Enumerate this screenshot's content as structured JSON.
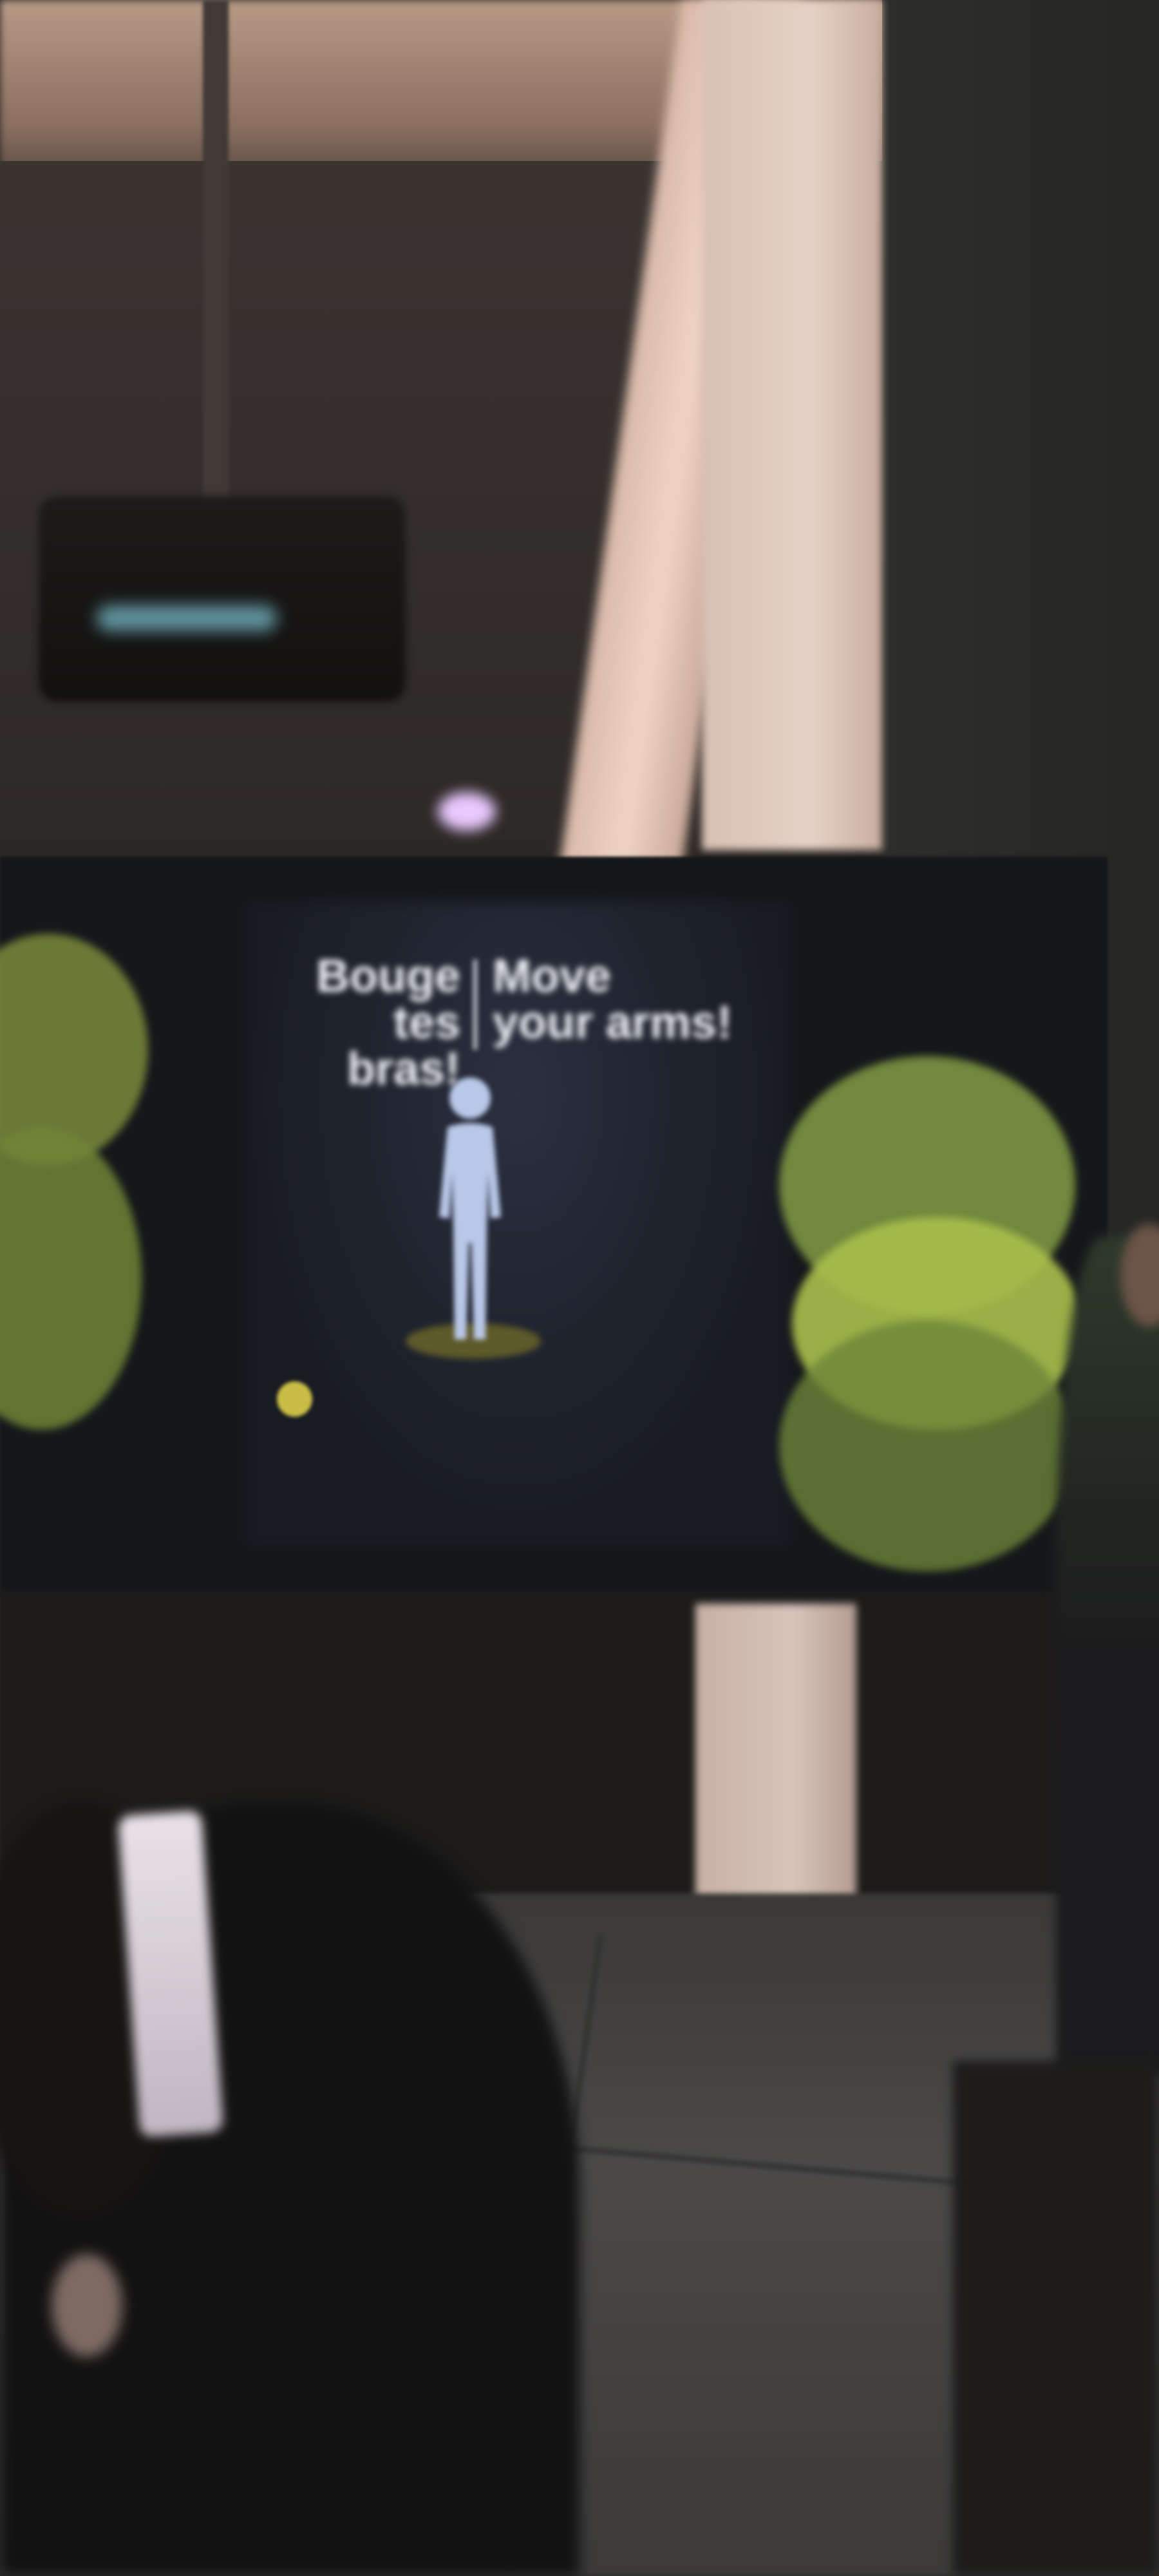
{
  "screen": {
    "title_fr": "Bouge\ntes bras!",
    "title_en": "Move\nyour arms!",
    "instruction": "",
    "note": ""
  },
  "colors": {
    "screen_background": "#15171a",
    "accent_green": "#a9c04c",
    "dot_yellow": "#c9bd46",
    "figure_blue": "#b9c7e8"
  },
  "icons": [
    "person-silhouette-icon",
    "yellow-dot-icon"
  ]
}
